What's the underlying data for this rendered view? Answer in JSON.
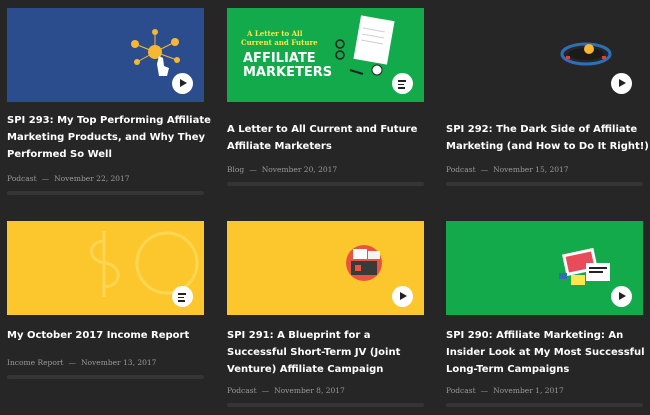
{
  "cards": [
    {
      "title": "SPI 293: My Top Performing Affiliate Marketing Products, and Why They Performed So Well",
      "category": "Podcast",
      "date": "November 22, 2017",
      "media": "play-icon"
    },
    {
      "title": "A Letter to All Current and Future Affiliate Marketers",
      "category": "Blog",
      "date": "November 20, 2017",
      "media": "document-icon",
      "art_text": {
        "line1": "A Letter to All",
        "line2": "Current and Future",
        "line3": "AFFILIATE",
        "line4": "MARKETERS"
      }
    },
    {
      "title": "SPI 292: The Dark Side of Affiliate Marketing (and How to Do It Right!)",
      "category": "Podcast",
      "date": "November 15, 2017",
      "media": "play-icon"
    },
    {
      "title": "My October 2017 Income Report",
      "category": "Income Report",
      "date": "November 13, 2017",
      "media": "document-icon"
    },
    {
      "title": "SPI 291: A Blueprint for a Successful Short-Term JV (Joint Venture) Affiliate Campaign",
      "category": "Podcast",
      "date": "November 8, 2017",
      "media": "play-icon"
    },
    {
      "title": "SPI 290: Affiliate Marketing: An Insider Look at My Most Successful Long-Term Campaigns",
      "category": "Podcast",
      "date": "November 1, 2017",
      "media": "play-icon"
    }
  ],
  "separator": "—",
  "colors": {
    "background": "#262626",
    "blue": "#2b4d8e",
    "green": "#12aa4b",
    "yellow": "#fcc72d"
  }
}
